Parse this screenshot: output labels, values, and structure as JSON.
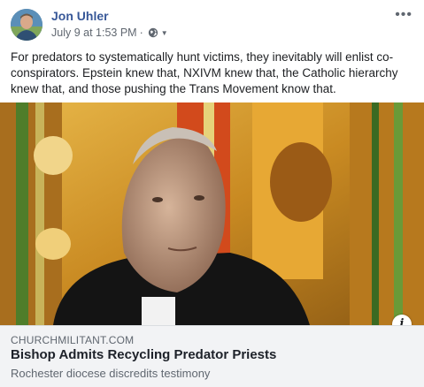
{
  "post": {
    "author": "Jon Uhler",
    "date": "July 9 at 1:53 PM",
    "separator": "·",
    "privacy_icon": "globe-icon",
    "audience_caret_icon": "caret-down-icon",
    "more_icon": "more-options-icon",
    "more_label": "•••",
    "text": "For predators to systematically hunt victims, they inevitably will enlist co-conspirators. Epstein knew that, NXIVM knew that, the Catholic hierarchy knew that, and those pushing the Trans Movement know that."
  },
  "link_preview": {
    "image_icon": "info-icon",
    "info_label": "i",
    "domain": "CHURCHMILITANT.COM",
    "headline": "Bishop Admits Recycling Predator Priests",
    "description": "Rochester diocese discredits testimony"
  },
  "colors": {
    "author_link": "#385898",
    "meta_text": "#606770",
    "link_box_bg": "#f2f3f5"
  }
}
